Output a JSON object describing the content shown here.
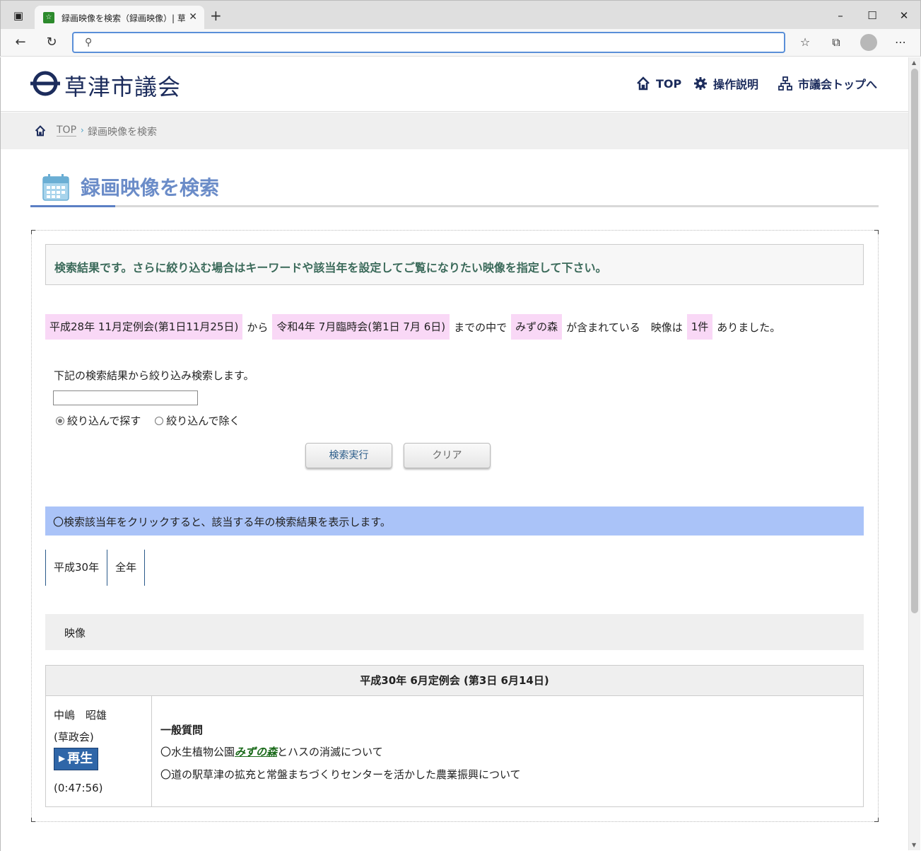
{
  "browser": {
    "tab_title": "録画映像を検索（録画映像）| 草",
    "tab_favicon_text": "☆",
    "address_value": ""
  },
  "header": {
    "logo_text": "草津市議会",
    "nav": [
      {
        "label": "TOP",
        "icon": "home-icon"
      },
      {
        "label": "操作説明",
        "icon": "gear-icon"
      },
      {
        "label": "市議会トップへ",
        "icon": "sitemap-icon"
      }
    ]
  },
  "breadcrumb": {
    "top": "TOP",
    "separator": "›",
    "current": "録画映像を検索"
  },
  "page": {
    "title": "録画映像を検索",
    "notice": "検索結果です。さらに絞り込む場合はキーワードや該当年を設定してご覧になりたい映像を指定して下さい。"
  },
  "result": {
    "from": "平成28年 11月定例会(第1日11月25日)",
    "from_suffix": "から",
    "to": "令和4年 7月臨時会(第1日 7月 6日)",
    "to_suffix": "までの中で",
    "keyword": "みずの森",
    "keyword_suffix": "が含まれている　映像は",
    "count": "1件",
    "count_suffix": "ありました。"
  },
  "refine": {
    "label": "下記の検索結果から絞り込み検索します。",
    "input_value": "",
    "radio_include": "絞り込んで探す",
    "radio_exclude": "絞り込んで除く",
    "search_button": "検索実行",
    "clear_button": "クリア"
  },
  "years": {
    "hint": "〇検索該当年をクリックすると、該当する年の検索結果を表示します。",
    "tabs": [
      "平成30年",
      "全年"
    ]
  },
  "videos": {
    "heading": "映像",
    "session": "平成30年 6月定例会 (第3日 6月14日)",
    "speaker": "中嶋　昭雄",
    "party": "(草政会)",
    "play_label": "再生",
    "duration": "(0:47:56)",
    "topic_heading": "一般質問",
    "topic1_prefix": "〇水生植物公園",
    "topic1_keyword": "みずの森",
    "topic1_suffix": "とハスの消滅について",
    "topic2": "〇道の駅草津の拡充と常盤まちづくりセンターを活かした農業振興について"
  },
  "colors": {
    "brand_navy": "#1c2c5c",
    "title_blue": "#6b8cc8",
    "highlight_pink": "#f9d8f6",
    "hint_blue": "#aac3f8",
    "play_blue": "#2f66a8"
  }
}
